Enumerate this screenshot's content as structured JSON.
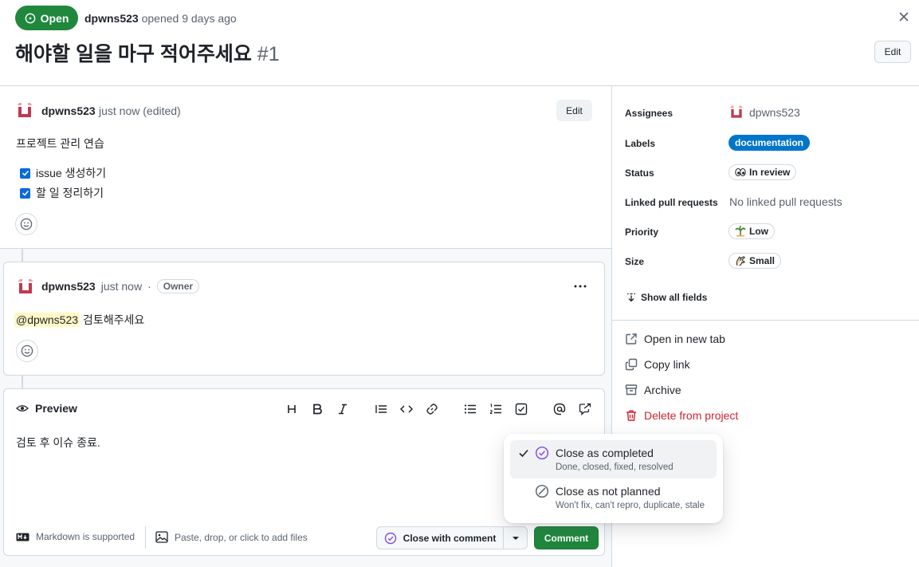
{
  "header": {
    "status_badge": "Open",
    "author": "dpwns523",
    "opened_text": "opened 9 days ago",
    "title": "해야할 일을 마구 적어주세요",
    "number": "#1",
    "edit_label": "Edit"
  },
  "comment1": {
    "author": "dpwns523",
    "meta": "just now (edited)",
    "edit_label": "Edit",
    "body": "프로젝트 관리 연습",
    "tasks": [
      {
        "label": "issue 생성하기",
        "checked": true
      },
      {
        "label": "할 일 정리하기",
        "checked": true
      }
    ]
  },
  "comment2": {
    "author": "dpwns523",
    "meta": "just now",
    "dot": "·",
    "badge": "Owner",
    "mention": "@dpwns523",
    "body": " 검토해주세요"
  },
  "composer": {
    "tab_label": "Preview",
    "toolbar_icons": [
      "heading-icon",
      "bold-icon",
      "italic-icon",
      "quote-icon",
      "code-icon",
      "link-icon",
      "bullet-list-icon",
      "numbered-list-icon",
      "task-list-icon",
      "mention-icon",
      "reference-icon"
    ],
    "content": "검토 후 이슈 종료.",
    "markdown_note": "Markdown is supported",
    "attach_note": "Paste, drop, or click to add files",
    "close_button": "Close with comment",
    "comment_button": "Comment"
  },
  "close_menu": {
    "items": [
      {
        "title": "Close as completed",
        "subtitle": "Done, closed, fixed, resolved",
        "selected": true
      },
      {
        "title": "Close as not planned",
        "subtitle": "Won't fix, can't repro, duplicate, stale",
        "selected": false
      }
    ]
  },
  "sidebar": {
    "assignees_label": "Assignees",
    "assignee": "dpwns523",
    "labels_label": "Labels",
    "label_value": "documentation",
    "status_label": "Status",
    "status_value": "In review",
    "linked_label": "Linked pull requests",
    "linked_value": "No linked pull requests",
    "priority_label": "Priority",
    "priority_value": "Low",
    "size_label": "Size",
    "size_value": "Small",
    "show_all": "Show all fields",
    "actions": {
      "open_new_tab": "Open in new tab",
      "copy_link": "Copy link",
      "archive": "Archive",
      "delete": "Delete from project"
    }
  },
  "colors": {
    "open_green": "#1f883d",
    "label_blue": "#0075ca",
    "danger_red": "#d1242f",
    "done_purple": "#8250df"
  }
}
